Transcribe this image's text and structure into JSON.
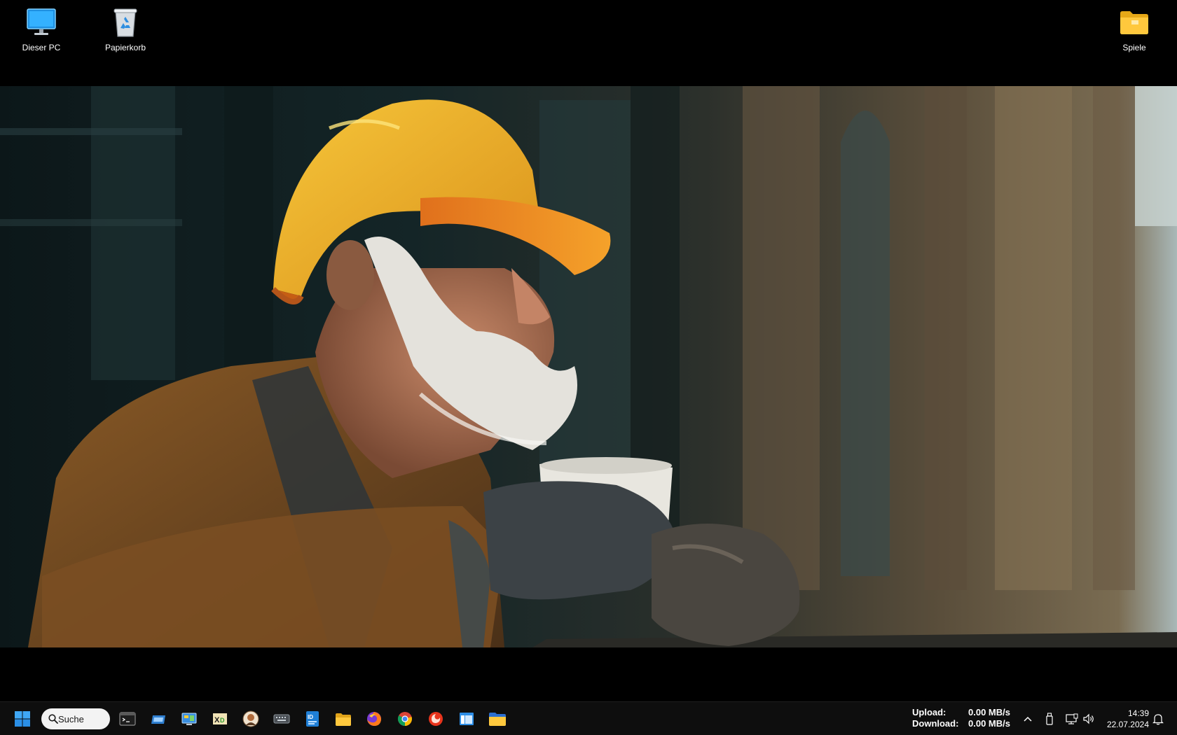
{
  "desktop": {
    "icons": [
      {
        "label": "Dieser PC",
        "icon": "monitor-icon"
      },
      {
        "label": "Papierkorb",
        "icon": "recycle-bin-icon"
      },
      {
        "label": "Spiele",
        "icon": "folder-icon"
      }
    ]
  },
  "wallpaper": {
    "subject": "photo"
  },
  "taskbar": {
    "start_icon": "windows-start-icon",
    "search": {
      "label": "Suche",
      "icon": "search-icon"
    },
    "apps": [
      {
        "icon": "terminal-icon"
      },
      {
        "icon": "drive-icon"
      },
      {
        "icon": "control-panel-icon"
      },
      {
        "icon": "xnview-icon"
      },
      {
        "icon": "app-portrait-icon"
      },
      {
        "icon": "keyboard-icon"
      },
      {
        "icon": "id-card-icon"
      },
      {
        "icon": "file-explorer-icon"
      },
      {
        "icon": "firefox-icon"
      },
      {
        "icon": "chrome-icon"
      },
      {
        "icon": "media-player-icon"
      },
      {
        "icon": "window-app-icon"
      },
      {
        "icon": "folder-icon"
      }
    ],
    "net_meter": {
      "upload_label": "Upload:",
      "upload_value": "0.00 MB/s",
      "download_label": "Download:",
      "download_value": "0.00 MB/s"
    },
    "tray": {
      "icons": [
        "chevron-up-icon",
        "usb-icon",
        "network-icon",
        "speaker-icon",
        "notification-bell-icon"
      ]
    },
    "clock": {
      "time": "14:39",
      "date": "22.07.2024"
    }
  },
  "colors": {
    "accent": "#0078d4",
    "taskbar_bg": "#0e0e0e",
    "desktop_bg": "#000000",
    "helmet": "#f2b41e"
  }
}
